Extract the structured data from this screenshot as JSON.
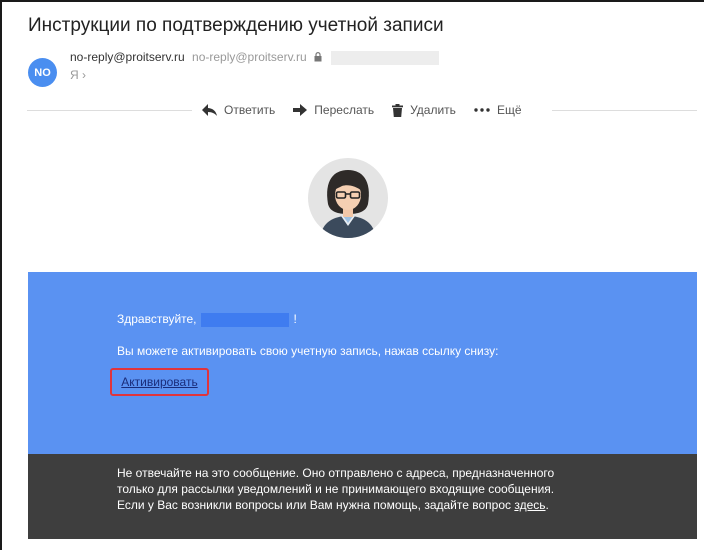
{
  "email": {
    "subject": "Инструкции по подтверждению учетной записи",
    "sender_initials": "NO",
    "sender_name": "no-reply@proitserv.ru",
    "sender_address": "no-reply@proitserv.ru",
    "recipient": "Я ›"
  },
  "toolbar": {
    "reply": "Ответить",
    "forward": "Переслать",
    "delete": "Удалить",
    "more": "Ещё"
  },
  "content": {
    "greeting_prefix": "Здравствуйте,",
    "greeting_suffix": "!",
    "body": "Вы можете активировать свою учетную запись, нажав ссылку снизу:",
    "activate_link": "Активировать"
  },
  "footer": {
    "line1": "Не отвечайте на это сообщение. Оно отправлено с адреса, предназначенного",
    "line2": "только для рассылки уведомлений и не принимающего входящие сообщения.",
    "line3": "Если у Вас возникли вопросы или Вам нужна помощь, задайте вопрос",
    "link": "здесь",
    "end": "."
  },
  "colors": {
    "panel": "#5a92f2",
    "footer": "#3e3e3e",
    "avatar": "#4a8ef0",
    "highlight": "#e0343c"
  }
}
